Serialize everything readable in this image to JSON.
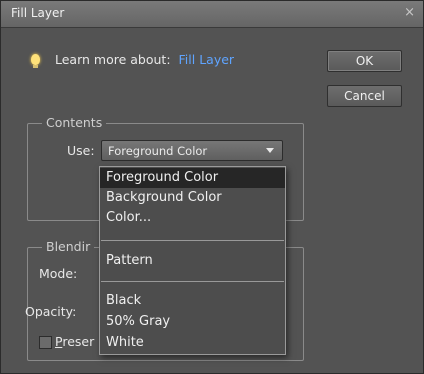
{
  "window": {
    "title": "Fill Layer",
    "close_glyph": "×"
  },
  "hint": {
    "prefix": "Learn more about:",
    "link": "Fill Layer"
  },
  "buttons": {
    "ok": "OK",
    "cancel": "Cancel"
  },
  "contents": {
    "group_label": "Contents",
    "use_label": "Use:",
    "selected": "Foreground Color"
  },
  "blending": {
    "group_label": "Blendir",
    "mode_label": "Mode:",
    "opacity_label": "Opacity:",
    "preserve_label_u": "P",
    "preserve_label_rest": "reser"
  },
  "dropdown": {
    "items": [
      "Foreground Color",
      "Background Color",
      "Color...",
      "Pattern",
      "Black",
      "50% Gray",
      "White"
    ]
  }
}
